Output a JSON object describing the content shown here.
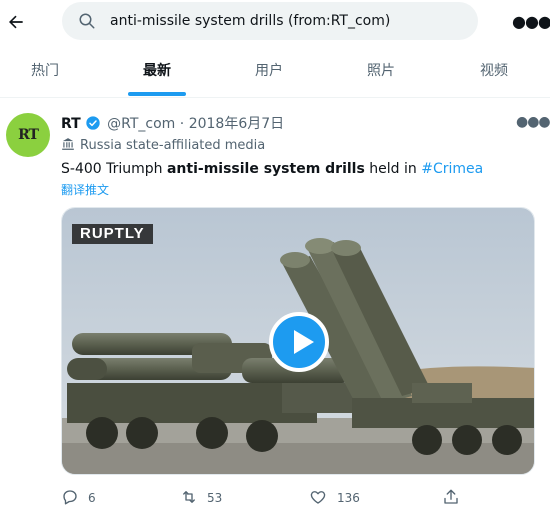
{
  "search": {
    "query": "anti-missile system drills (from:RT_com)"
  },
  "tabs": [
    {
      "label": "热门"
    },
    {
      "label": "最新"
    },
    {
      "label": "用户"
    },
    {
      "label": "照片"
    },
    {
      "label": "视频"
    }
  ],
  "active_tab": "最新",
  "tweet": {
    "avatar_text": "RT",
    "name": "RT",
    "handle": "@RT_com",
    "separator": "·",
    "date": "2018年6月7日",
    "label": "Russia state-affiliated media",
    "text_prefix": "S-400 Triumph ",
    "text_bold": "anti-missile system drills",
    "text_middle": " held in ",
    "hashtag": "#Crimea",
    "translate": "翻译推文",
    "media": {
      "watermark": "RUPTLY"
    },
    "actions": {
      "replies": "6",
      "retweets": "53",
      "likes": "136"
    }
  },
  "colors": {
    "accent": "#1d9bf0",
    "avatar_bg": "#8bd03f",
    "muted_text": "#536471"
  },
  "icons": [
    "back-arrow-icon",
    "search-icon",
    "more-icon",
    "verified-icon",
    "state-media-icon",
    "play-icon",
    "reply-icon",
    "retweet-icon",
    "like-icon",
    "share-icon"
  ]
}
